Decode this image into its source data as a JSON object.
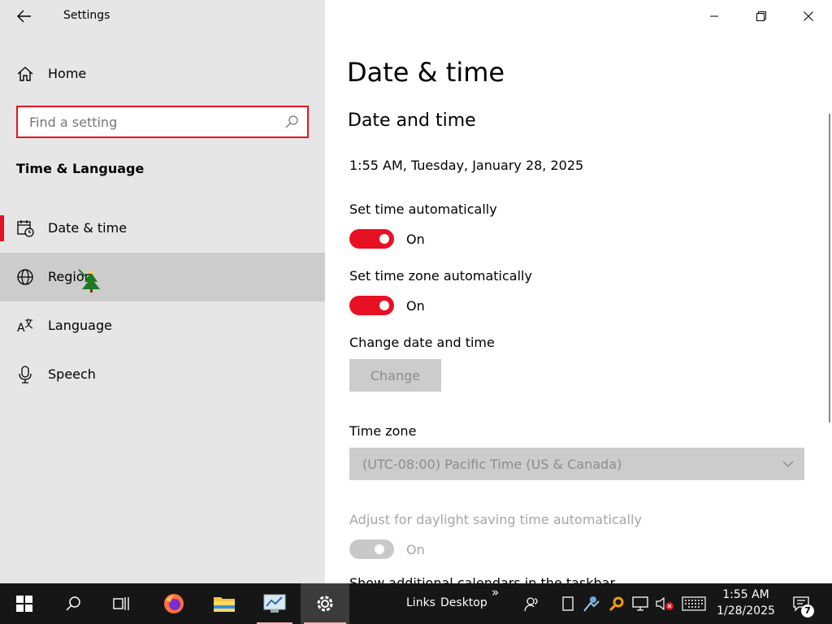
{
  "app": {
    "title": "Settings"
  },
  "sidebar": {
    "home_label": "Home",
    "search_placeholder": "Find a setting",
    "section_title": "Time & Language",
    "items": [
      {
        "label": "Date & time",
        "icon": "calendar-clock-icon",
        "active": true
      },
      {
        "label": "Region",
        "icon": "globe-icon",
        "hover": true
      },
      {
        "label": "Language",
        "icon": "language-icon"
      },
      {
        "label": "Speech",
        "icon": "microphone-icon"
      }
    ]
  },
  "main": {
    "page_title": "Date & time",
    "section_title": "Date and time",
    "current_datetime": "1:55 AM, Tuesday, January 28, 2025",
    "set_time_auto": {
      "label": "Set time automatically",
      "state": "On"
    },
    "set_tz_auto": {
      "label": "Set time zone automatically",
      "state": "On"
    },
    "change_datetime": {
      "label": "Change date and time",
      "button": "Change"
    },
    "time_zone": {
      "label": "Time zone",
      "value": "(UTC-08:00) Pacific Time (US & Canada)"
    },
    "daylight": {
      "label": "Adjust for daylight saving time automatically",
      "state": "On"
    },
    "cutoff_label": "Show additional calendars in the taskbar"
  },
  "taskbar": {
    "toolbar_links": "Links",
    "toolbar_desktop": "Desktop",
    "overflow": "»",
    "clock_time": "1:55 AM",
    "clock_date": "1/28/2025",
    "notification_count": "7"
  },
  "colors": {
    "accent": "#e81123",
    "sidebar_bg": "#e6e6e6",
    "taskbar_bg": "#161616"
  }
}
